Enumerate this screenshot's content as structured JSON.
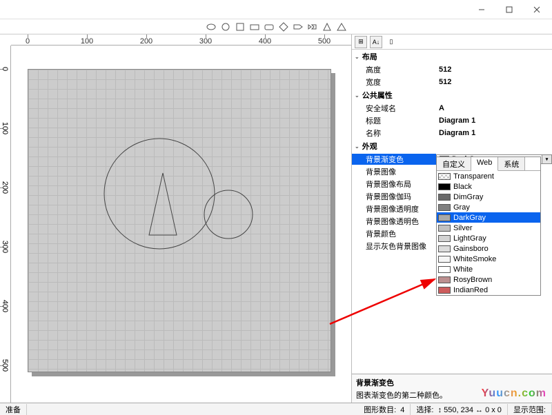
{
  "win": {
    "min": "—",
    "max": "☐",
    "close": "✕"
  },
  "ruler": {
    "h": [
      "0",
      "100",
      "200",
      "300",
      "400",
      "500"
    ],
    "v": [
      "0",
      "100",
      "200",
      "300",
      "400",
      "500"
    ]
  },
  "props": {
    "cat_layout": "布局",
    "height_l": "高度",
    "height_v": "512",
    "width_l": "宽度",
    "width_v": "512",
    "cat_public": "公共属性",
    "domain_l": "安全域名",
    "domain_v": "A",
    "title_l": "标题",
    "title_v": "Diagram 1",
    "name_l": "名称",
    "name_v": "Diagram 1",
    "cat_appearance": "外观",
    "bggrad_l": "背景渐变色",
    "bggrad_v": "DarkGray",
    "bgimg_l": "背景图像",
    "bgimglayout_l": "背景图像布局",
    "bgimggamma_l": "背景图像伽玛",
    "bgimgopacity_l": "背景图像透明度",
    "bgimgopcolor_l": "背景图像透明色",
    "bgcolor_l": "背景颜色",
    "showgraybg_l": "显示灰色背景图像"
  },
  "popup": {
    "tab_custom": "自定义",
    "tab_web": "Web",
    "tab_system": "系统",
    "colors": [
      {
        "n": "Transparent",
        "c": "#ffffff"
      },
      {
        "n": "Black",
        "c": "#000000"
      },
      {
        "n": "DimGray",
        "c": "#696969"
      },
      {
        "n": "Gray",
        "c": "#808080"
      },
      {
        "n": "DarkGray",
        "c": "#a9a9a9"
      },
      {
        "n": "Silver",
        "c": "#c0c0c0"
      },
      {
        "n": "LightGray",
        "c": "#d3d3d3"
      },
      {
        "n": "Gainsboro",
        "c": "#dcdcdc"
      },
      {
        "n": "WhiteSmoke",
        "c": "#f5f5f5"
      },
      {
        "n": "White",
        "c": "#ffffff"
      },
      {
        "n": "RosyBrown",
        "c": "#bc8f8f"
      },
      {
        "n": "IndianRed",
        "c": "#cd5c5c"
      }
    ],
    "selected": "DarkGray"
  },
  "desc": {
    "title": "背景渐变色",
    "body": "图表渐变色的第二种颜色。"
  },
  "status": {
    "ready": "准备",
    "shapes_l": "图形数目:",
    "shapes_v": "4",
    "sel_l": "选择:",
    "sel_v": "↕ 550, 234  ↔ 0 x 0",
    "range_l": "显示范围:"
  },
  "wm": "Yuucn.com"
}
